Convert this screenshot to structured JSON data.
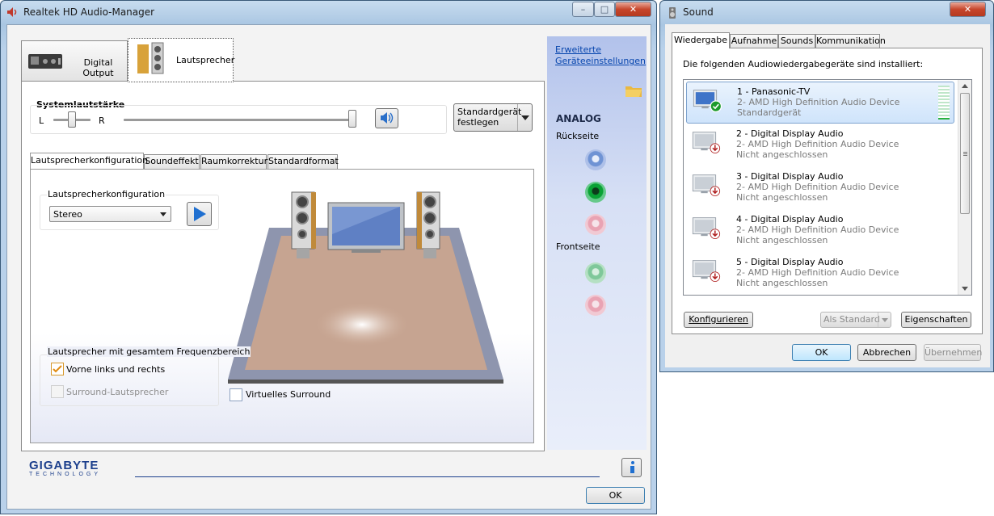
{
  "realtek": {
    "title": "Realtek HD Audio-Manager",
    "caption": {
      "minimize": "–",
      "maximize": "□",
      "close": "✕"
    },
    "device_tabs": [
      {
        "label": "Digital Output"
      },
      {
        "label": "Lautsprecher"
      }
    ],
    "advanced_link": [
      "Erweiterte",
      "Geräteeinstellungen"
    ],
    "volume": {
      "label": "Systemlautstärke",
      "left": "L",
      "right": "R",
      "balance": 0.5,
      "level": 1.0
    },
    "default_device_btn": [
      "Standardgerät",
      "festlegen"
    ],
    "inner_tabs": [
      "Lautsprecherkonfiguration",
      "Soundeffekt",
      "Raumkorrektur",
      "Standardformat"
    ],
    "config_group": {
      "label": "Lautsprecherkonfiguration",
      "selected": "Stereo"
    },
    "fullrange_group": {
      "label": "Lautsprecher mit gesamtem Frequenzbereich",
      "front": {
        "label": "Vorne links und rechts",
        "checked": true
      },
      "surround": {
        "label": "Surround-Lautsprecher",
        "checked": false,
        "disabled": true
      }
    },
    "virtual_surround": {
      "label": "Virtuelles Surround",
      "checked": false
    },
    "analog": {
      "heading": "ANALOG",
      "back_label": "Rückseite",
      "front_label": "Frontseite",
      "jack_colors": {
        "blue": "#6f93d4",
        "green": "#0aa235",
        "pink": "#e9a3b3",
        "green_inactive": "#7fc89a"
      }
    },
    "brand": {
      "name": "GIGABYTE",
      "sub": "TECHNOLOGY"
    },
    "info_icon": "info-icon",
    "ok": "OK"
  },
  "sound": {
    "title": "Sound",
    "caption": {
      "close": "✕"
    },
    "tabs": [
      "Wiedergabe",
      "Aufnahme",
      "Sounds",
      "Kommunikation"
    ],
    "intro": "Die folgenden Audiowiedergabegeräte sind installiert:",
    "devices": [
      {
        "name": "1 - Panasonic-TV",
        "desc": "2- AMD High Definition Audio Device",
        "status": "Standardgerät",
        "default": true
      },
      {
        "name": "2 - Digital Display Audio",
        "desc": "2- AMD High Definition Audio Device",
        "status": "Nicht angeschlossen",
        "default": false
      },
      {
        "name": "3 - Digital Display Audio",
        "desc": "2- AMD High Definition Audio Device",
        "status": "Nicht angeschlossen",
        "default": false
      },
      {
        "name": "4 - Digital Display Audio",
        "desc": "2- AMD High Definition Audio Device",
        "status": "Nicht angeschlossen",
        "default": false
      },
      {
        "name": "5 - Digital Display Audio",
        "desc": "2- AMD High Definition Audio Device",
        "status": "Nicht angeschlossen",
        "default": false
      }
    ],
    "buttons": {
      "configure": "Konfigurieren",
      "set_default": "Als Standard",
      "properties": "Eigenschaften",
      "ok": "OK",
      "cancel": "Abbrechen",
      "apply": "Übernehmen"
    }
  }
}
